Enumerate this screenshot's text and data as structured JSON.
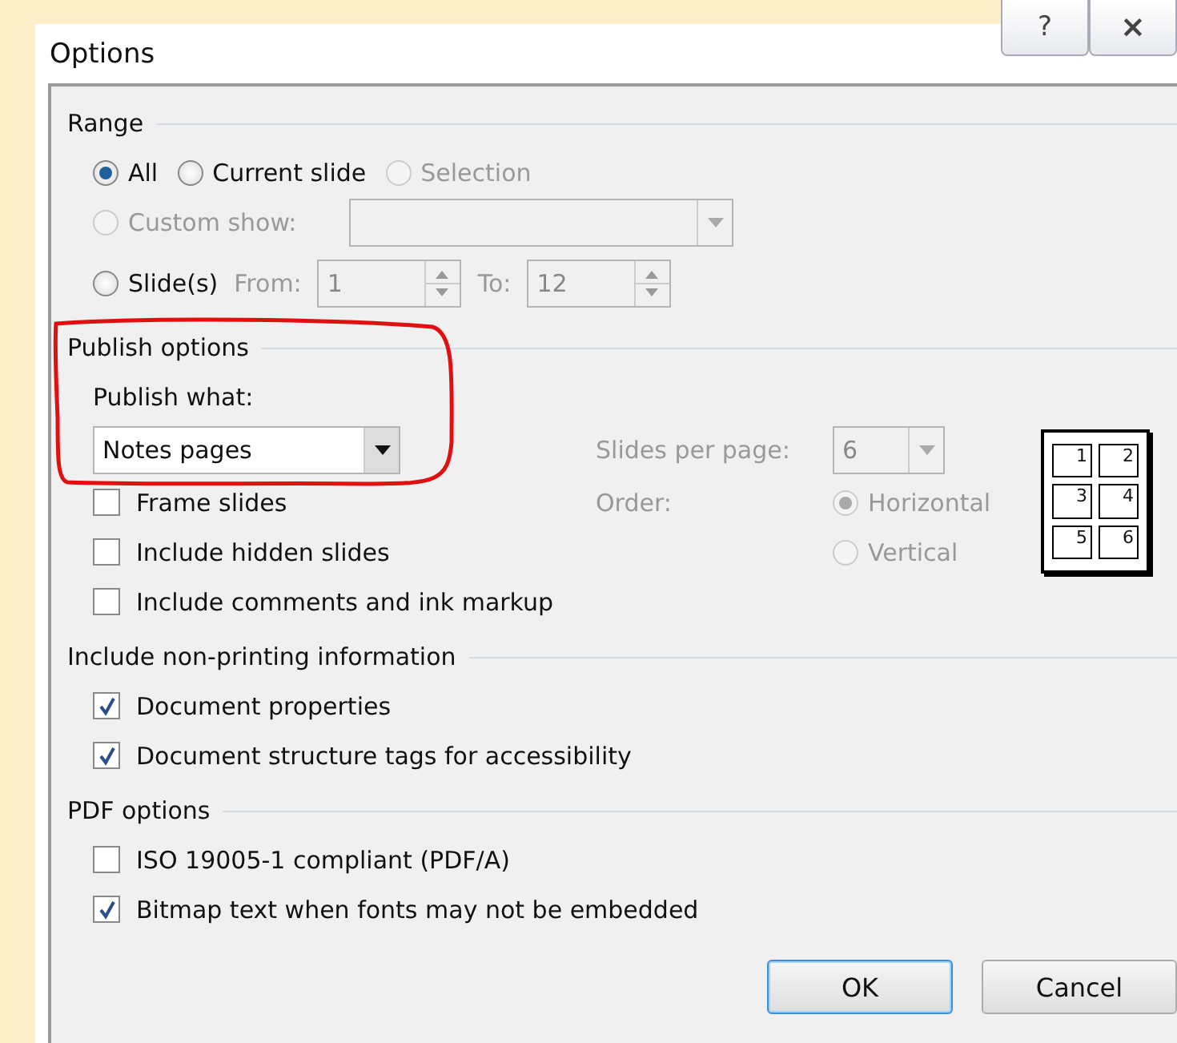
{
  "window": {
    "title": "Options",
    "buttons": [
      {
        "kind": "help",
        "label": "?"
      },
      {
        "kind": "close",
        "label": "⨯"
      }
    ]
  },
  "range": {
    "title": "Range",
    "scope": [
      {
        "label": "All",
        "selected": true,
        "disabled": false
      },
      {
        "label": "Current slide",
        "selected": false,
        "disabled": false
      },
      {
        "label": "Selection",
        "selected": false,
        "disabled": true
      }
    ],
    "custom_show": {
      "label": "Custom show:",
      "selected": false,
      "disabled": true
    },
    "slides": {
      "label": "Slide(s)",
      "selected": false,
      "disabled": false,
      "from_label": "From:",
      "from_value": "1",
      "to_label": "To:",
      "to_value": "12"
    }
  },
  "publish": {
    "title": "Publish options",
    "what_label": "Publish what:",
    "what_value": "Notes pages",
    "checks": [
      {
        "label": "Frame slides",
        "checked": false
      },
      {
        "label": "Include hidden slides",
        "checked": false
      },
      {
        "label": "Include comments and ink markup",
        "checked": false
      }
    ],
    "slides_per_page_label": "Slides per page:",
    "slides_per_page_value": "6",
    "order_label": "Order:",
    "order": [
      {
        "label": "Horizontal",
        "selected": true
      },
      {
        "label": "Vertical",
        "selected": false
      }
    ],
    "layout_preview": [
      "1",
      "2",
      "3",
      "4",
      "5",
      "6"
    ]
  },
  "non_printing": {
    "title": "Include non-printing information",
    "checks": [
      {
        "label": "Document properties",
        "checked": true
      },
      {
        "label": "Document structure tags for accessibility",
        "checked": true
      }
    ]
  },
  "pdf": {
    "title": "PDF options",
    "checks": [
      {
        "label": "ISO 19005-1 compliant (PDF/A)",
        "checked": false
      },
      {
        "label": "Bitmap text when fonts may not be embedded",
        "checked": true
      }
    ]
  },
  "buttons": [
    {
      "label": "OK",
      "default": true
    },
    {
      "label": "Cancel",
      "default": false
    }
  ]
}
